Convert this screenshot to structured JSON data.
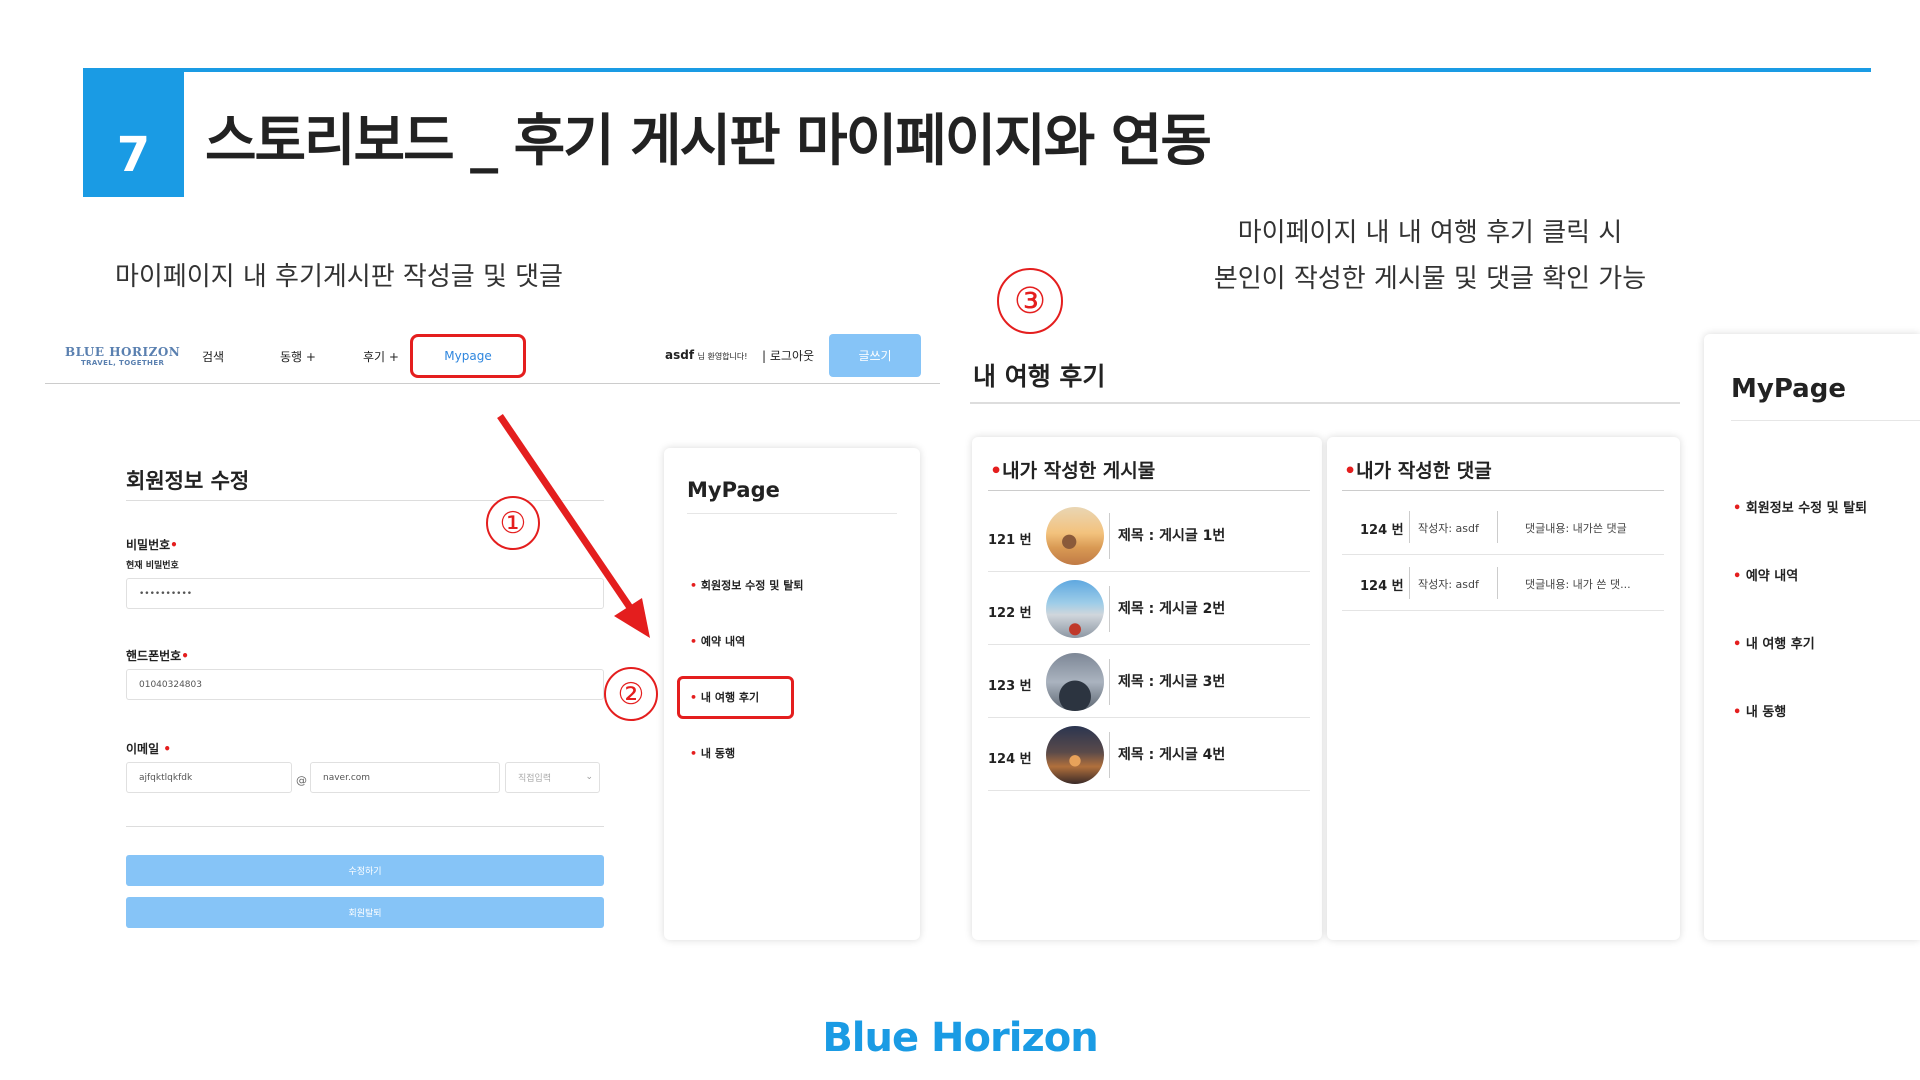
{
  "slide": {
    "number": "7",
    "title": "스토리보드 _  후기 게시판 마이페이지와 연동",
    "caption_left": "마이페이지 내 후기게시판 작성글 및 댓글",
    "caption_right_line1": "마이페이지 내 내 여행 후기 클릭 시",
    "caption_right_line2": "본인이 작성한 게시물 및 댓글 확인 가능",
    "footer": "Blue Horizon"
  },
  "annotations": {
    "step1": "①",
    "step2": "②",
    "step3": "③"
  },
  "nav": {
    "logo_line1": "BLUE HORIZON",
    "logo_line2": "TRAVEL, TOGETHER",
    "search": "검색",
    "companion": "동행 +",
    "review": "후기 +",
    "mypage": "Mypage",
    "username": "asdf",
    "welcome": "님 환영합니다!",
    "divider": "|",
    "logout": "로그아웃",
    "write": "글쓰기"
  },
  "member_form": {
    "title": "회원정보 수정",
    "password_label": "비밀번호",
    "required_mark": "•",
    "current_password_label": "현재 비밀번호",
    "password_value": "••••••••••",
    "phone_label": "핸드폰번호",
    "phone_value": "01040324803",
    "email_label": "이메일",
    "email_id": "ajfqktlqkfdk",
    "email_at": "@",
    "email_domain": "naver.com",
    "email_select": "직접입력",
    "save_button": "수정하기",
    "withdraw_button": "회원탈퇴"
  },
  "mypage_menu": {
    "title": "MyPage",
    "items": [
      "회원정보 수정 및 탈퇴",
      "예약 내역",
      "내 여행 후기",
      "내 동행"
    ]
  },
  "reviews": {
    "title": "내 여행 후기",
    "posts_header": "내가 작성한 게시물",
    "comments_header": "내가 작성한 댓글",
    "posts": [
      {
        "num": "121 번",
        "title": "제목 : 게시글 1번"
      },
      {
        "num": "122 번",
        "title": "제목 : 게시글 2번"
      },
      {
        "num": "123 번",
        "title": "제목 : 게시글 3번"
      },
      {
        "num": "124 번",
        "title": "제목 : 게시글 4번"
      }
    ],
    "comments": [
      {
        "num": "124 번",
        "author": "작성자: asdf",
        "text": "댓글내용: 내가쓴 댓글"
      },
      {
        "num": "124 번",
        "author": "작성자: asdf",
        "text": "댓글내용: 내가 쓴 댓..."
      }
    ]
  },
  "colors": {
    "accent": "#1a9be4",
    "highlight": "#e41e1e",
    "button": "#86c4f7"
  }
}
